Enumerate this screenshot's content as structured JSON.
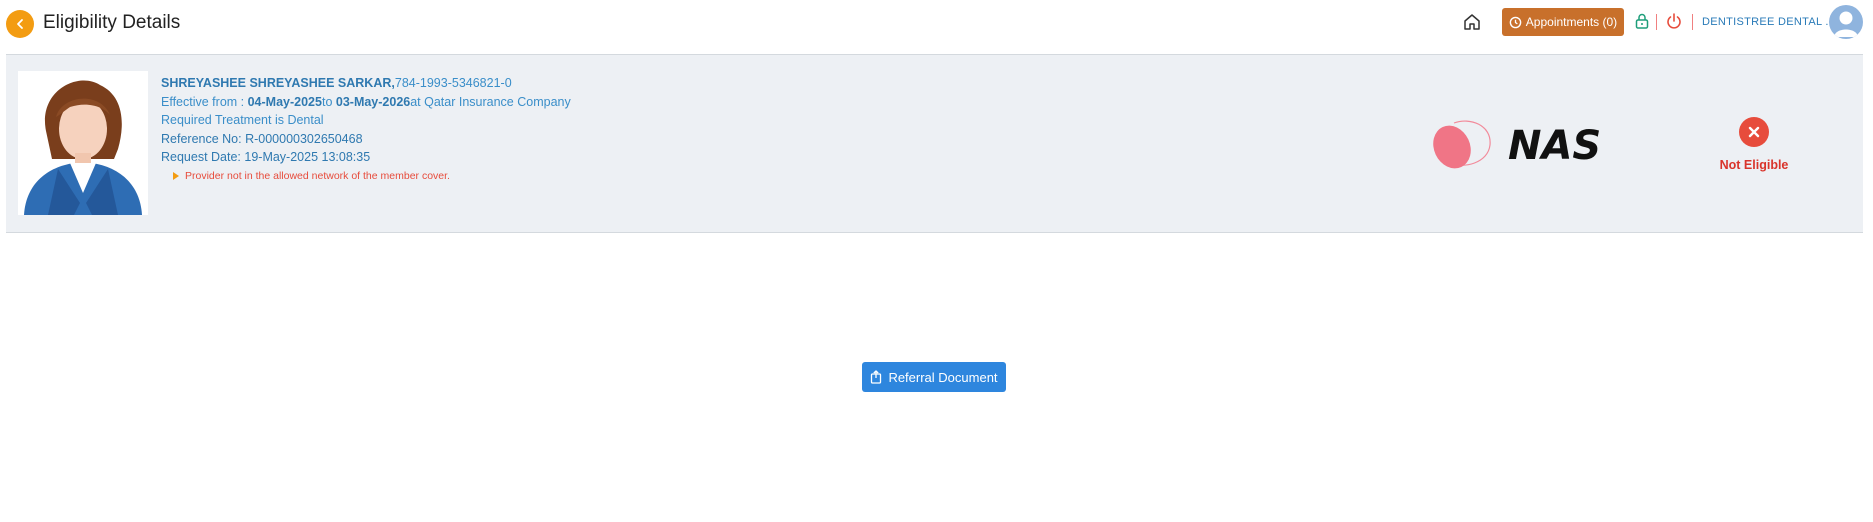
{
  "header": {
    "title": "Eligibility Details",
    "appointments_label": "Appointments (0)",
    "user_name": "DENTISTREE DENTAL ..."
  },
  "member": {
    "name": "SHREYASHEE SHREYASHEE SARKAR,",
    "id": "784-1993-5346821-0",
    "effective_prefix": "Effective from : ",
    "effective_from": "04-May-2025",
    "to_label": "to ",
    "effective_to": "03-May-2026",
    "insurer": "at Qatar Insurance Company",
    "treatment": "Required Treatment is Dental",
    "reference": "Reference No: R-000000302650468",
    "request_date": "Request Date: 19-May-2025 13:08:35",
    "error_message": "Provider not in the allowed network of the member cover."
  },
  "payer_logo_text": "NAS",
  "status": {
    "label": "Not Eligible",
    "color": "#e74c3c"
  },
  "actions": {
    "referral_label": "Referral Document"
  },
  "colors": {
    "accent_orange": "#f39c12",
    "appointments_bg": "#c8702b",
    "primary_blue": "#2e86de",
    "text_blue": "#3a8ec9"
  }
}
